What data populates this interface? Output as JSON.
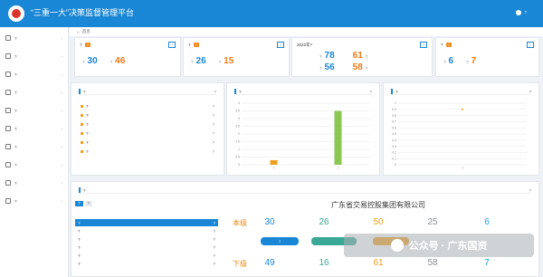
{
  "header": {
    "app_title": "“三重一大”决策监督管理平台",
    "user_name": "?"
  },
  "breadcrumb": {
    "home": "首页"
  },
  "sidebar": {
    "items": [
      {
        "label": "?"
      },
      {
        "label": "?"
      },
      {
        "label": "?"
      },
      {
        "label": "?"
      },
      {
        "label": "?"
      },
      {
        "label": "?"
      },
      {
        "label": "?"
      },
      {
        "label": "?"
      },
      {
        "label": "?"
      },
      {
        "label": "?"
      }
    ]
  },
  "stats": [
    {
      "title": "?",
      "badge": "?",
      "tag": "?",
      "v1": "30",
      "u1": "?",
      "v2": "46",
      "u2": "?"
    },
    {
      "title": "?",
      "badge": "?",
      "tag": "?",
      "v1": "26",
      "u1": "?",
      "v2": "15",
      "u2": "?"
    },
    {
      "title": "2022年?",
      "tag": "?",
      "v1": "78",
      "u1": "?",
      "v2": "56",
      "u2": "?",
      "v3": "61",
      "u3": "?",
      "v4": "58",
      "u4": "?"
    },
    {
      "title": "?",
      "badge": "?",
      "tag": "?",
      "v1": "6",
      "u1": "?",
      "v2": "7",
      "u2": "?"
    }
  ],
  "news": {
    "title": "?",
    "more": "?",
    "items": [
      {
        "text": "?",
        "date": "?"
      },
      {
        "text": "?",
        "date": "?"
      },
      {
        "text": "?",
        "date": "?"
      },
      {
        "text": "?",
        "date": "?"
      },
      {
        "text": "?",
        "date": "?"
      },
      {
        "text": "?",
        "date": "?"
      }
    ]
  },
  "chart_panels": [
    {
      "title": "?",
      "more": "?"
    },
    {
      "title": "?",
      "more": "?"
    }
  ],
  "chart_data": [
    {
      "type": "bar",
      "categories": [
        "?",
        "?"
      ],
      "series": [
        {
          "values": [
            0.3,
            3.5
          ]
        }
      ],
      "ylim": [
        0,
        4
      ],
      "yticks": [
        "0",
        "0.5",
        "1",
        "1.5",
        "2",
        "2.5",
        "3",
        "3.5",
        "4"
      ]
    },
    {
      "type": "scatter",
      "categories": [
        "?"
      ],
      "series": [
        {
          "values": [
            0.9
          ]
        }
      ],
      "ylim": [
        0,
        1
      ],
      "yticks": [
        "0",
        "0.1",
        "0.2",
        "0.3",
        "0.4",
        "0.5",
        "0.6",
        "0.7",
        "0.8",
        "0.9",
        "1"
      ]
    }
  ],
  "table": {
    "title": "?",
    "more": "?",
    "tabs": [
      "?",
      "?"
    ],
    "rows": [
      {
        "name": "?",
        "count": "?"
      },
      {
        "name": "?",
        "count": "?"
      },
      {
        "name": "?",
        "count": "?"
      },
      {
        "name": "?",
        "count": "?"
      },
      {
        "name": "?",
        "count": "?"
      },
      {
        "name": "?",
        "count": "?"
      }
    ]
  },
  "org": {
    "title": "广东省交易控股集团有限公司",
    "level1": "本级",
    "level2": "下级",
    "upper": [
      "30",
      "26",
      "50",
      "25",
      "6"
    ],
    "lower": [
      "49",
      "16",
      "61",
      "58",
      "7"
    ],
    "pill_label": "?",
    "colors": [
      "#1a87d6",
      "#3aa896",
      "#f0a020",
      "#8a8f96",
      "#1aa2e6"
    ]
  },
  "watermark": {
    "text": "公众号 · 广东国资"
  }
}
